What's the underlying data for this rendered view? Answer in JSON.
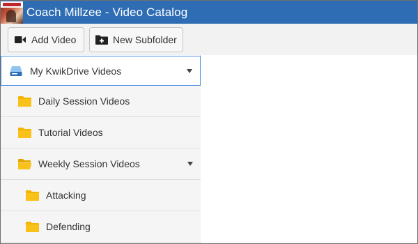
{
  "window": {
    "title": "Coach Millzee - Video Catalog",
    "logo_icon": "app-logo-icon",
    "accent": "#2e6db4"
  },
  "toolbar": {
    "add_video": {
      "label": "Add Video",
      "icon": "video-camera-icon"
    },
    "new_subfolder": {
      "label": "New Subfolder",
      "icon": "folder-plus-icon"
    }
  },
  "sidebar": {
    "root": {
      "label": "My KwikDrive Videos",
      "icon": "drive-icon",
      "expanded": true
    },
    "items": [
      {
        "label": "Daily Session Videos",
        "icon": "folder-icon",
        "level": 1,
        "has_children": false
      },
      {
        "label": "Tutorial Videos",
        "icon": "folder-icon",
        "level": 1,
        "has_children": false
      },
      {
        "label": "Weekly Session Videos",
        "icon": "folder-open-icon",
        "level": 1,
        "has_children": true,
        "expanded": true
      },
      {
        "label": "Attacking",
        "icon": "folder-icon",
        "level": 2,
        "has_children": false
      },
      {
        "label": "Defending",
        "icon": "folder-icon",
        "level": 2,
        "has_children": false
      }
    ],
    "folder_color": "#f5b400"
  }
}
